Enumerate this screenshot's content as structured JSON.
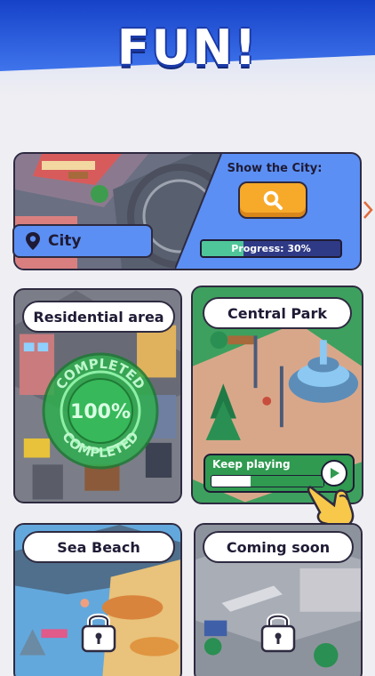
{
  "header": {
    "title": "FUN!"
  },
  "city_card": {
    "name": "City",
    "show_label": "Show the City:",
    "progress_text": "Progress: 30%",
    "progress_fraction": 0.3
  },
  "tiles": {
    "residential": {
      "label": "Residential area",
      "stamp_top": "COMPLETED",
      "stamp_value": "100%",
      "stamp_bottom": "COMPLETED"
    },
    "central_park": {
      "label": "Central Park",
      "keep_playing": "Keep playing",
      "progress_fraction": 0.35
    },
    "sea_beach": {
      "label": "Sea Beach"
    },
    "coming_soon": {
      "label": "Coming soon"
    }
  },
  "icons": {
    "search": "search-icon",
    "map_pin": "map-pin-icon",
    "lock": "lock-icon",
    "play": "play-icon",
    "chevron": "chevron-right-icon",
    "hand": "pointing-hand-icon"
  },
  "colors": {
    "header_blue": "#1e4fd6",
    "accent_orange": "#f7a92a",
    "progress_green": "#4fc59a",
    "park_green": "#2f9a50",
    "stamp_green": "#2fae4f"
  }
}
